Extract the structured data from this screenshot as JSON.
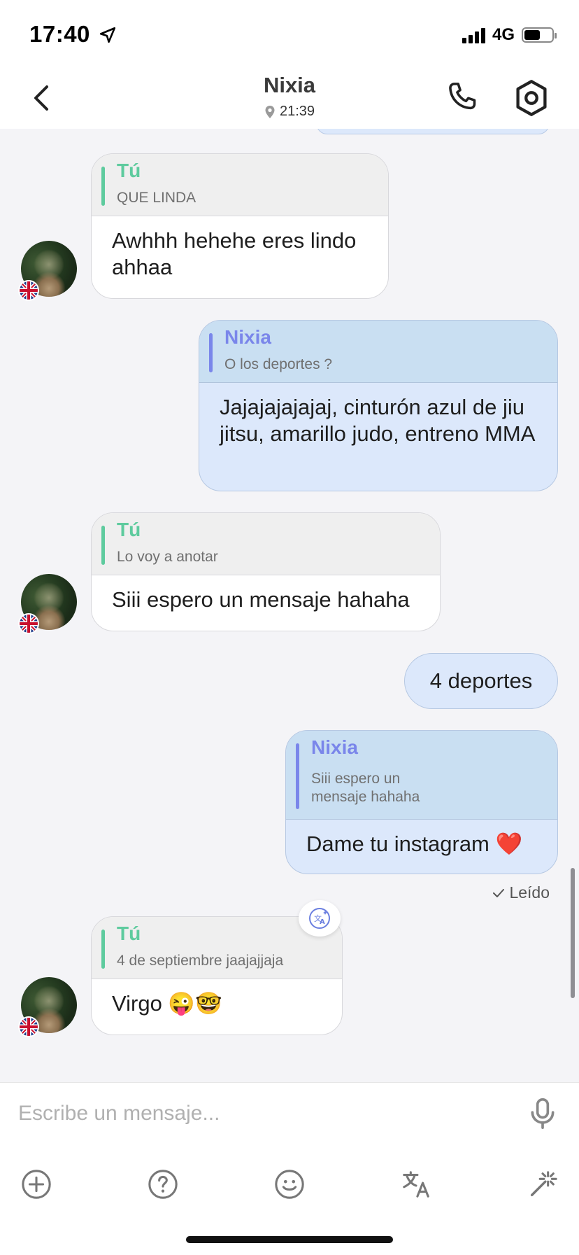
{
  "status": {
    "time": "17:40",
    "network": "4G"
  },
  "header": {
    "title": "Nixia",
    "location_time": "21:39"
  },
  "messages": [
    {
      "side": "received",
      "quote_name": "Tú",
      "quote_text": "QUE LINDA",
      "text": "Awhhh hehehe eres lindo ahhaa"
    },
    {
      "side": "sent",
      "quote_name": "Nixia",
      "quote_text": "O los deportes ?",
      "text": "Jajajajajajaj, cinturón azul de jiu jitsu, amarillo judo, entreno MMA"
    },
    {
      "side": "received",
      "quote_name": "Tú",
      "quote_text": "Lo voy a anotar",
      "text": "Siii espero un mensaje hahaha"
    },
    {
      "side": "sent",
      "text": "4 deportes"
    },
    {
      "side": "sent",
      "quote_name": "Nixia",
      "quote_text": "Siii espero un mensaje hahaha",
      "text": "Dame tu instagram ❤️"
    },
    {
      "side": "received",
      "quote_name": "Tú",
      "quote_text": "4 de septiembre jaajajjaja",
      "text": "Virgo 😜🤓"
    }
  ],
  "read_receipt": "Leído",
  "composer": {
    "placeholder": "Escribe un mensaje..."
  },
  "icons": {
    "back": "chevron-left-icon",
    "call": "phone-icon",
    "settings": "hexagon-settings-icon",
    "mic": "microphone-icon",
    "add": "plus-circle-icon",
    "help": "question-circle-icon",
    "emoji": "smiley-icon",
    "translate": "translate-icon",
    "magic": "magic-wand-icon"
  },
  "colors": {
    "sent_bubble": "#dce8fb",
    "received_bubble": "#ffffff",
    "self_quote": "#5ecb9e",
    "partner_quote": "#7a86ea",
    "background": "#f4f4f7"
  }
}
